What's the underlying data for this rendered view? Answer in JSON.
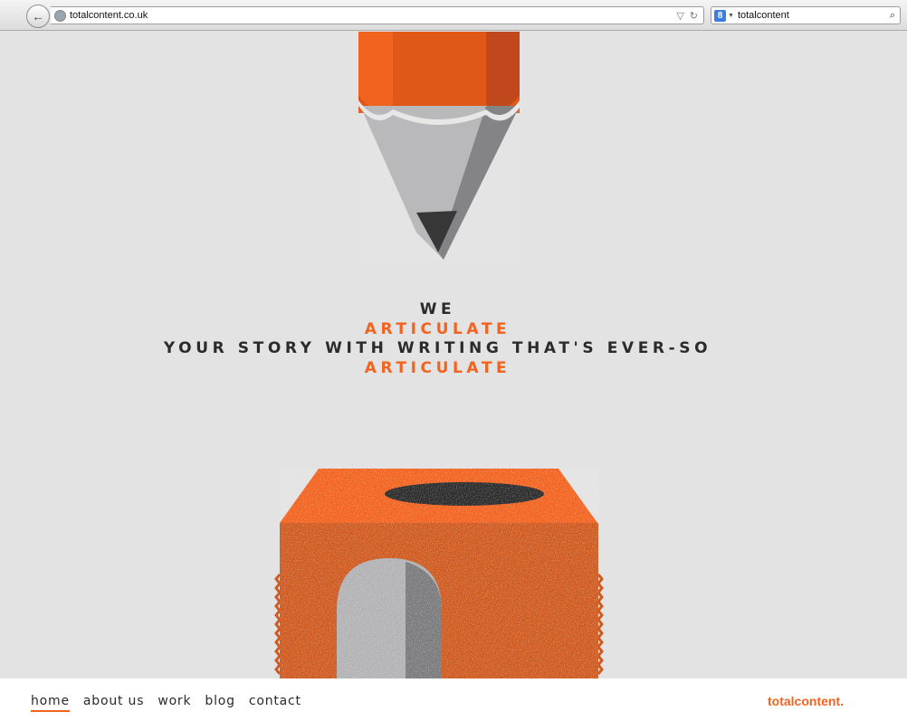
{
  "browser": {
    "url": "totalcontent.co.uk",
    "search_query": "totalcontent",
    "back_icon": "back-arrow-icon",
    "reload_icon": "reload-icon",
    "search_engine_icon": "google-icon"
  },
  "headline": {
    "line1": "WE",
    "line2": "ARTICULATE",
    "line3": "YOUR STORY WITH WRITING THAT'S EVER-SO",
    "line4": "ARTICULATE"
  },
  "nav": {
    "items": [
      "home",
      "about us",
      "work",
      "blog",
      "contact"
    ],
    "active": "home"
  },
  "brand": "totalcontent.",
  "colors": {
    "accent": "#f26320",
    "background": "#e3e3e3",
    "text": "#2b2b2b"
  }
}
